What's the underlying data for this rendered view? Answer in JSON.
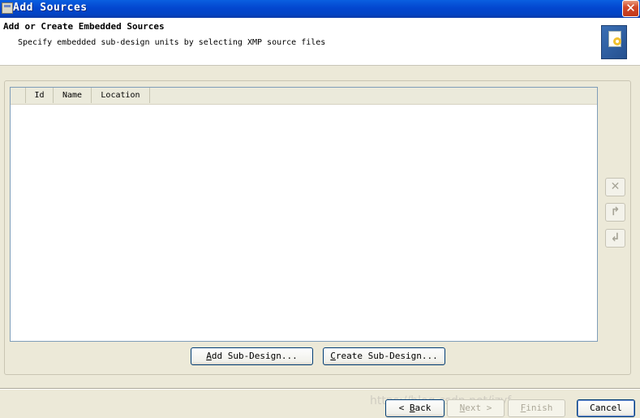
{
  "window": {
    "title": "Add Sources",
    "close_glyph": "✕"
  },
  "header": {
    "title": "Add or Create Embedded Sources",
    "subtitle": "Specify embedded sub-design units by selecting XMP source files",
    "icon": "wizard-sources-icon"
  },
  "table": {
    "columns": [
      "",
      "Id",
      "Name",
      "Location"
    ],
    "rows": []
  },
  "side_buttons": [
    {
      "icon": "remove-icon",
      "glyph": "✕"
    },
    {
      "icon": "move-up-icon",
      "glyph": "↱"
    },
    {
      "icon": "move-down-icon",
      "glyph": "↲"
    }
  ],
  "actions": {
    "add_sub_design": {
      "prefix": "",
      "mnemonic": "A",
      "rest": "dd Sub-Design..."
    },
    "create_sub_design": {
      "prefix": "",
      "mnemonic": "C",
      "rest": "reate Sub-Design..."
    }
  },
  "footer": {
    "back": {
      "prefix": "< ",
      "mnemonic": "B",
      "rest": "ack"
    },
    "next": {
      "prefix": "",
      "mnemonic": "N",
      "rest": "ext >"
    },
    "finish": {
      "prefix": "",
      "mnemonic": "F",
      "rest": "inish"
    },
    "cancel": "Cancel"
  },
  "watermark": "https://blog.csdn.net/jzyf..."
}
